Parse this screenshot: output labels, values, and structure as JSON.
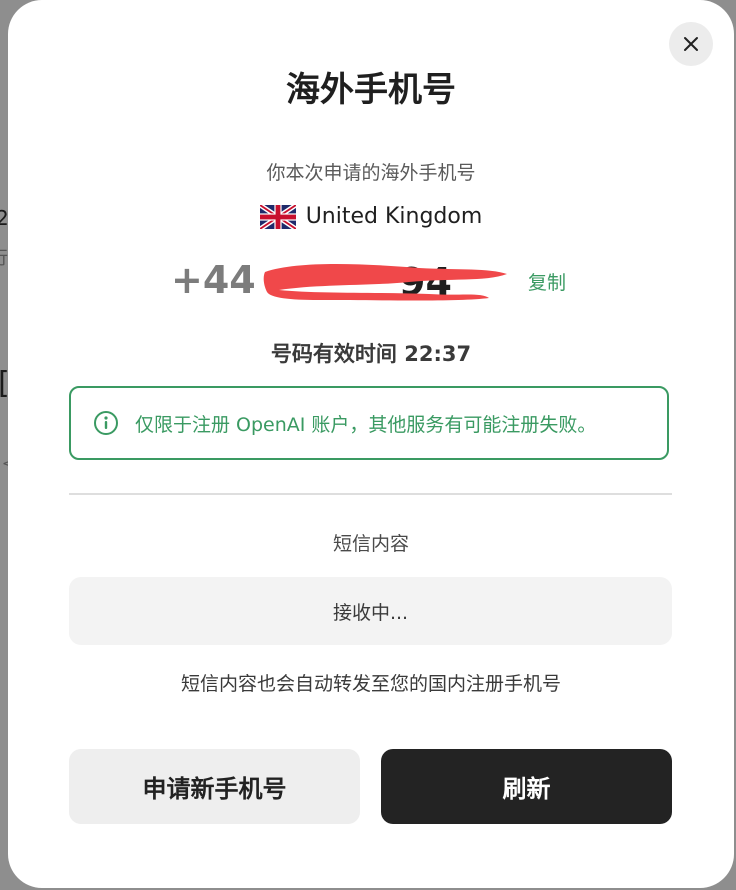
{
  "background": {
    "fragments": [
      "2",
      "行",
      "[",
      "<"
    ]
  },
  "modal": {
    "title": "海外手机号",
    "close_icon": "close-icon",
    "subtitle": "你本次申请的海外手机号",
    "country": {
      "flag_icon": "uk-flag-icon",
      "name": "United Kingdom"
    },
    "phone": {
      "prefix": "+44",
      "visible_tail": "94",
      "redaction_color": "#f0484a"
    },
    "copy_label": "复制",
    "validity": {
      "label": "号码有效时间",
      "time": "22:37",
      "full": "号码有效时间 22:37"
    },
    "notice": {
      "icon": "info-icon",
      "text": "仅限于注册 OpenAI 账户，其他服务有可能注册失败。",
      "color": "#3a9a62"
    },
    "sms": {
      "label": "短信内容",
      "status": "接收中...",
      "forward_note": "短信内容也会自动转发至您的国内注册手机号"
    },
    "buttons": {
      "new_number": "申请新手机号",
      "refresh": "刷新"
    }
  }
}
